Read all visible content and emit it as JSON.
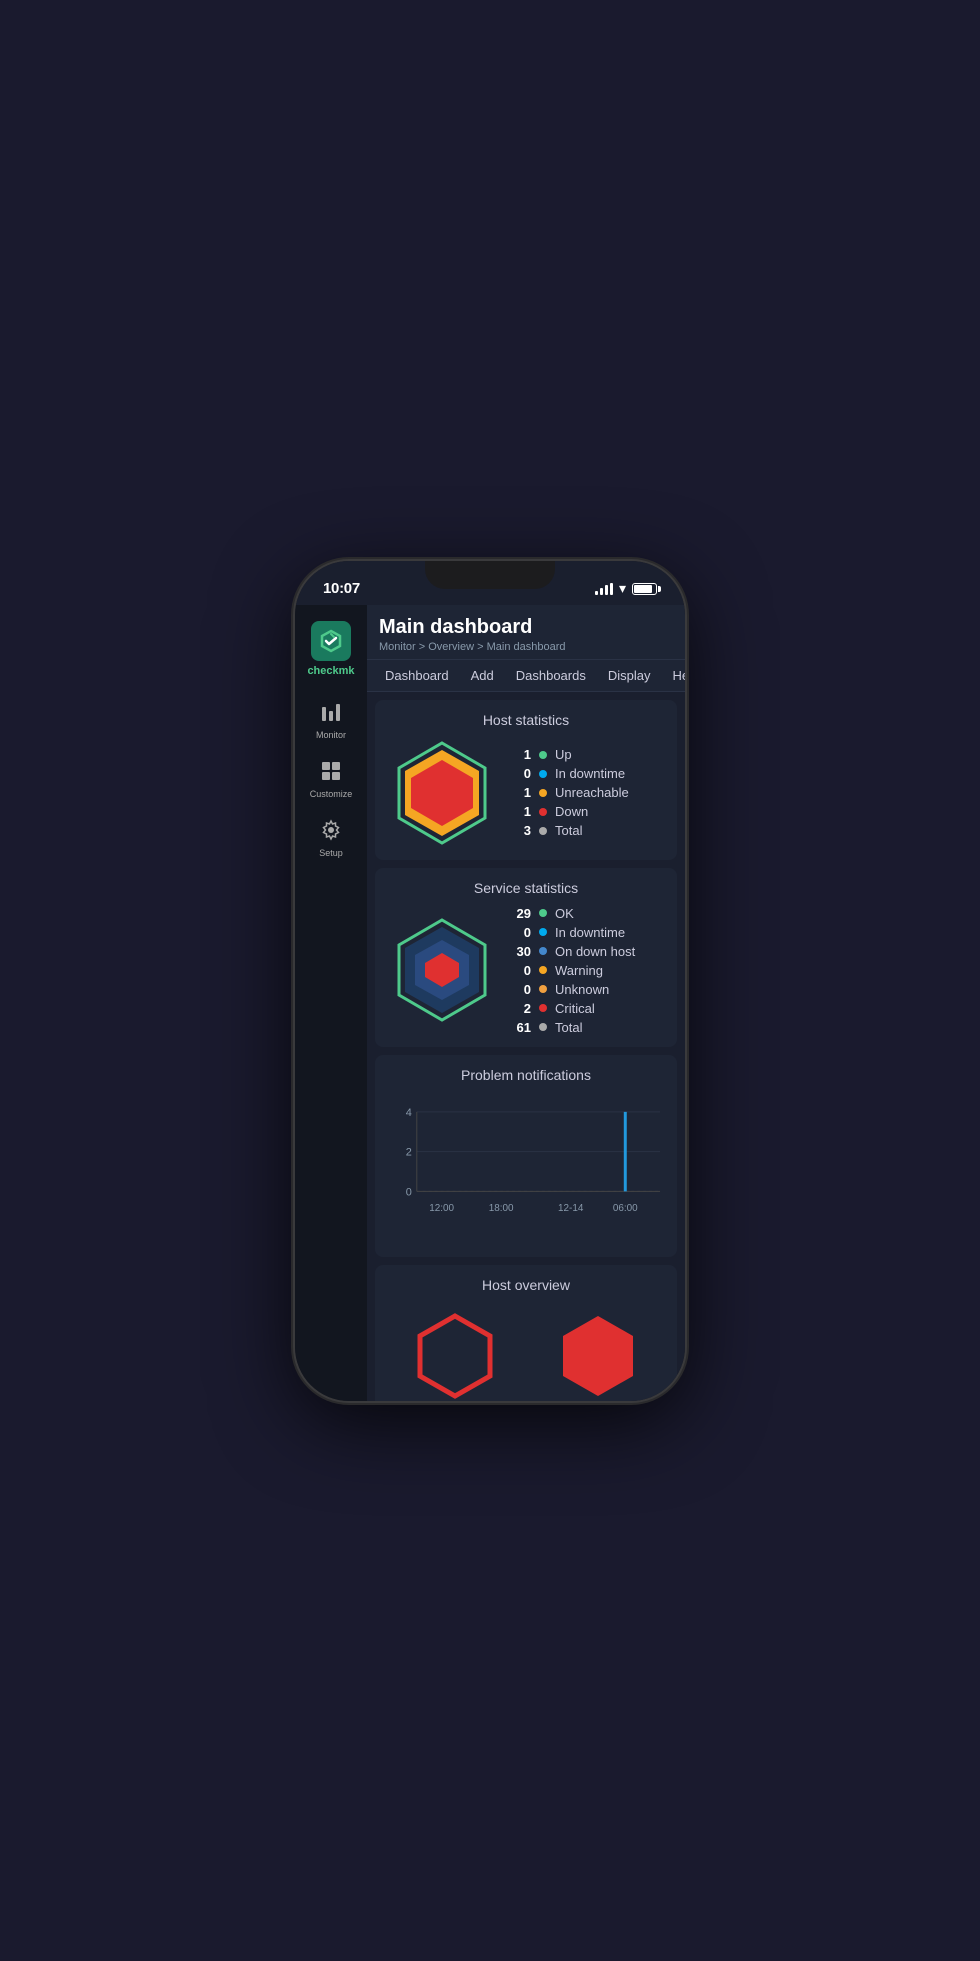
{
  "status_bar": {
    "time": "10:07"
  },
  "sidebar": {
    "logo_text_check": "check",
    "logo_text_mk": "mk",
    "nav_items": [
      {
        "id": "monitor",
        "icon": "📊",
        "label": "Monitor"
      },
      {
        "id": "customize",
        "icon": "⊞",
        "label": "Customize"
      },
      {
        "id": "setup",
        "icon": "⚙",
        "label": "Setup"
      }
    ]
  },
  "header": {
    "title": "Main dashboard",
    "breadcrumb": "Monitor > Overview > Main dashboard"
  },
  "top_nav": {
    "tabs": [
      {
        "id": "dashboard",
        "label": "Dashboard"
      },
      {
        "id": "add",
        "label": "Add"
      },
      {
        "id": "dashboards",
        "label": "Dashboards"
      },
      {
        "id": "display",
        "label": "Display"
      },
      {
        "id": "help",
        "label": "Help"
      }
    ]
  },
  "host_statistics": {
    "title": "Host statistics",
    "stats": [
      {
        "num": "1",
        "color": "#4eca8b",
        "label": "Up"
      },
      {
        "num": "0",
        "color": "#00aaee",
        "label": "In downtime"
      },
      {
        "num": "1",
        "color": "#f5a623",
        "label": "Unreachable"
      },
      {
        "num": "1",
        "color": "#e03030",
        "label": "Down"
      },
      {
        "num": "3",
        "color": "#aaaaaa",
        "label": "Total"
      }
    ]
  },
  "service_statistics": {
    "title": "Service statistics",
    "stats": [
      {
        "num": "29",
        "color": "#4eca8b",
        "label": "OK"
      },
      {
        "num": "0",
        "color": "#00aaee",
        "label": "In downtime"
      },
      {
        "num": "30",
        "color": "#4488cc",
        "label": "On down host"
      },
      {
        "num": "0",
        "color": "#f5a623",
        "label": "Warning"
      },
      {
        "num": "0",
        "color": "#f0a040",
        "label": "Unknown"
      },
      {
        "num": "2",
        "color": "#e03030",
        "label": "Critical"
      },
      {
        "num": "61",
        "color": "#aaaaaa",
        "label": "Total"
      }
    ]
  },
  "problem_notifications": {
    "title": "Problem notifications",
    "y_labels": [
      "4",
      "2",
      "0"
    ],
    "x_labels": [
      "12:00",
      "18:00",
      "12-14",
      "06:00"
    ]
  },
  "host_overview": {
    "title": "Host overview"
  },
  "colors": {
    "bg_main": "#1a1f2e",
    "bg_card": "#1e2535",
    "bg_sidebar": "#12161f",
    "accent_green": "#4eca8b",
    "accent_red": "#e03030",
    "accent_orange": "#f5a623"
  }
}
